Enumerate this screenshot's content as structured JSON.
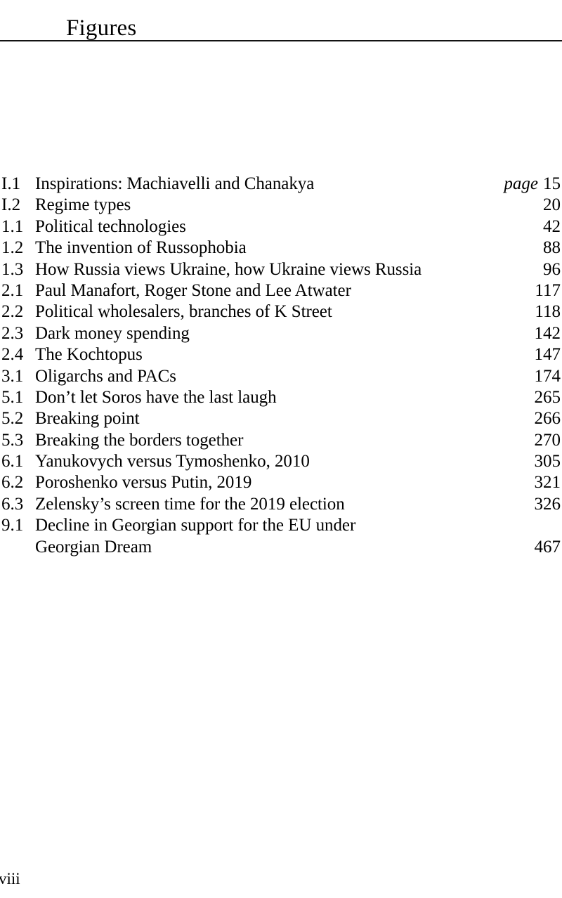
{
  "heading": {
    "title": "Figures"
  },
  "page_label": "page",
  "figures": [
    {
      "number": "I.1",
      "title": "Inspirations: Machiavelli and Chanakya",
      "page": "15",
      "show_page_word": true
    },
    {
      "number": "I.2",
      "title": "Regime types",
      "page": "20",
      "show_page_word": false
    },
    {
      "number": "1.1",
      "title": "Political technologies",
      "page": "42",
      "show_page_word": false
    },
    {
      "number": "1.2",
      "title": "The invention of Russophobia",
      "page": "88",
      "show_page_word": false
    },
    {
      "number": "1.3",
      "title": "How Russia views Ukraine, how Ukraine views Russia",
      "page": "96",
      "show_page_word": false
    },
    {
      "number": "2.1",
      "title": "Paul Manafort, Roger Stone and Lee Atwater",
      "page": "117",
      "show_page_word": false
    },
    {
      "number": "2.2",
      "title": "Political wholesalers, branches of K Street",
      "page": "118",
      "show_page_word": false
    },
    {
      "number": "2.3",
      "title": "Dark money spending",
      "page": "142",
      "show_page_word": false
    },
    {
      "number": "2.4",
      "title": "The Kochtopus",
      "page": "147",
      "show_page_word": false
    },
    {
      "number": "3.1",
      "title": "Oligarchs and PACs",
      "page": "174",
      "show_page_word": false
    },
    {
      "number": "5.1",
      "title": "Don’t let Soros have the last laugh",
      "page": "265",
      "show_page_word": false
    },
    {
      "number": "5.2",
      "title": "Breaking point",
      "page": "266",
      "show_page_word": false
    },
    {
      "number": "5.3",
      "title": "Breaking the borders together",
      "page": "270",
      "show_page_word": false
    },
    {
      "number": "6.1",
      "title": "Yanukovych versus Tymoshenko, 2010",
      "page": "305",
      "show_page_word": false
    },
    {
      "number": "6.2",
      "title": "Poroshenko versus Putin, 2019",
      "page": "321",
      "show_page_word": false
    },
    {
      "number": "6.3",
      "title": "Zelensky’s screen time for the 2019 election",
      "page": "326",
      "show_page_word": false
    },
    {
      "number": "9.1",
      "title": "Decline in Georgian support for the EU under",
      "page": "",
      "show_page_word": false
    },
    {
      "number": "",
      "title": "Georgian Dream",
      "page": "467",
      "show_page_word": false,
      "continuation": true
    }
  ],
  "folio": "viii"
}
